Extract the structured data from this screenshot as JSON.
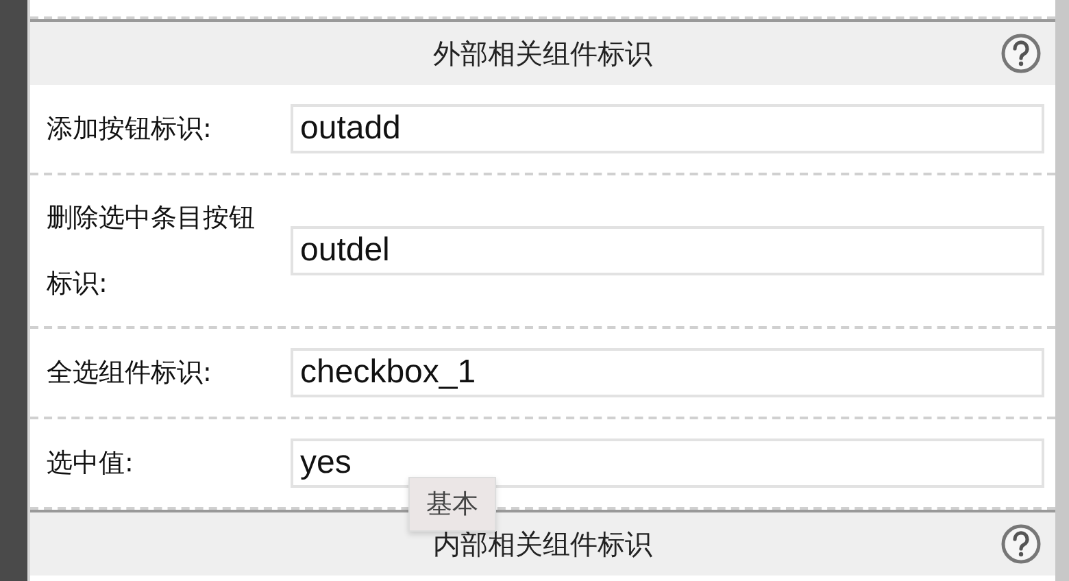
{
  "sections": [
    {
      "title": "外部相关组件标识",
      "fields": [
        {
          "label": "添加按钮标识:",
          "value": "outadd"
        },
        {
          "label": "删除选中条目按钮标识:",
          "value": "outdel"
        },
        {
          "label": "全选组件标识:",
          "value": "checkbox_1"
        },
        {
          "label": "选中值:",
          "value": "yes"
        }
      ]
    },
    {
      "title": "内部相关组件标识"
    }
  ],
  "tooltip": "基本"
}
